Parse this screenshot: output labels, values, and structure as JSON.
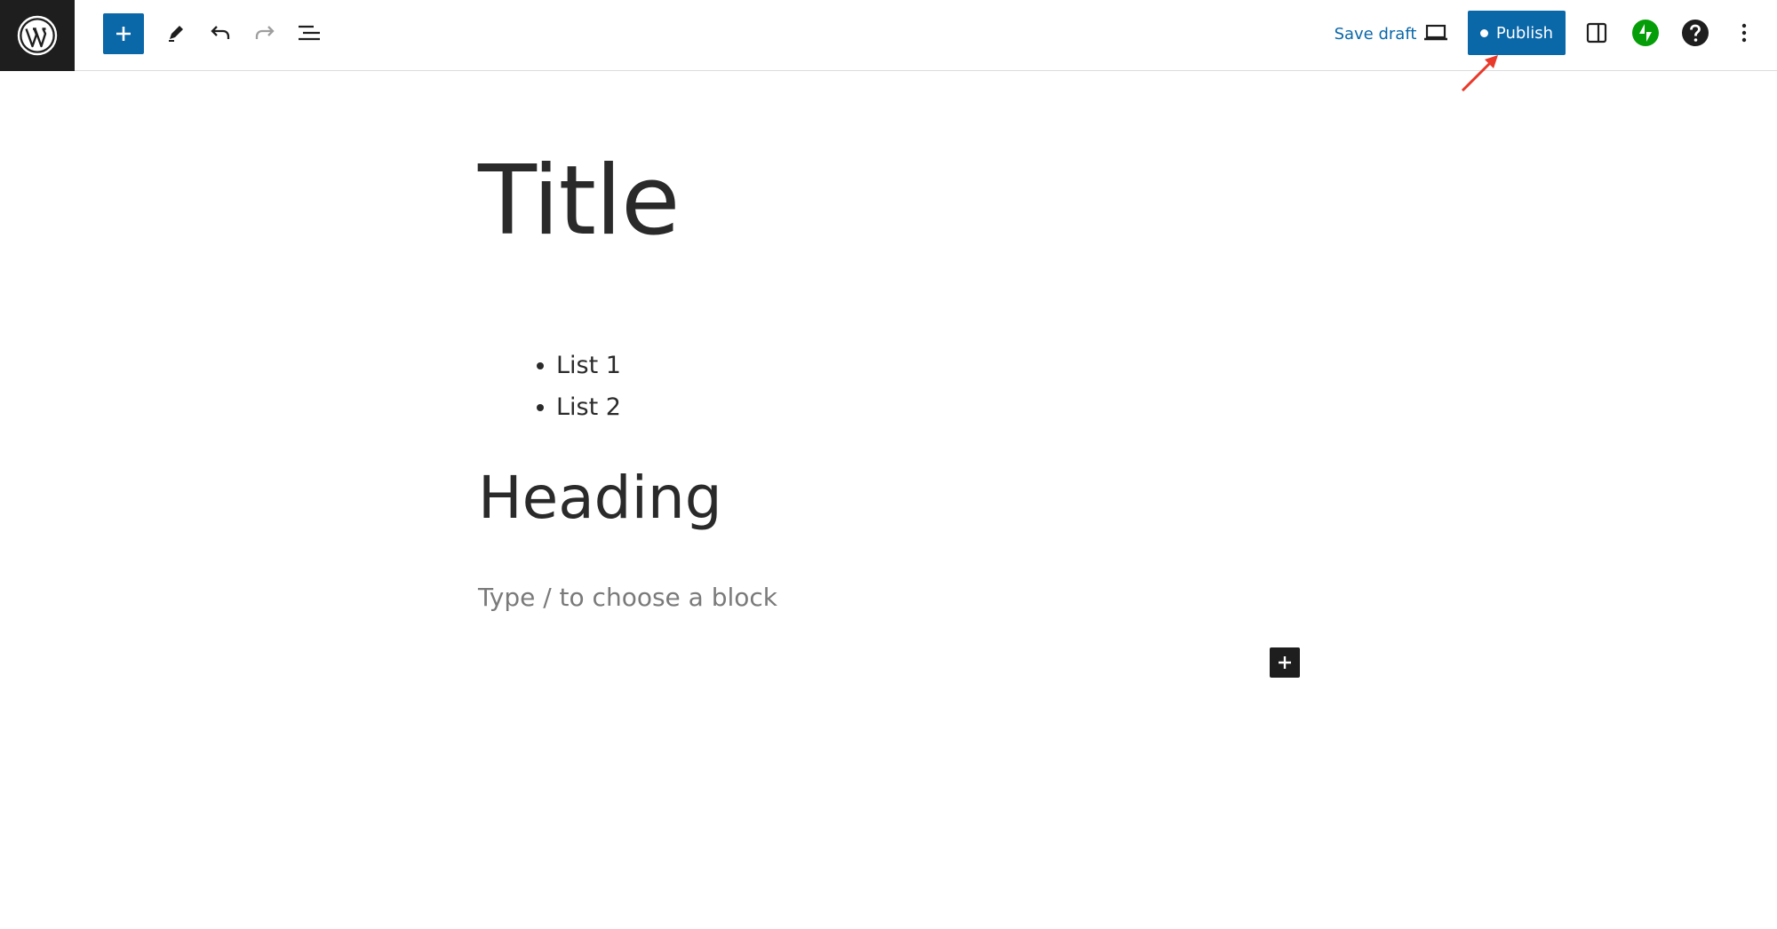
{
  "toolbar": {
    "logo_icon": "wordpress-logo-icon",
    "inserter_icon": "plus-icon",
    "tools_icon": "pencil-icon",
    "undo_icon": "undo-icon",
    "redo_icon": "redo-icon",
    "list_view_icon": "list-view-icon",
    "save_draft_label": "Save draft",
    "preview_icon": "laptop-icon",
    "publish_label": "Publish",
    "settings_icon": "sidebar-toggle-icon",
    "jetpack_icon": "jetpack-bolt-icon",
    "help_icon": "help-icon",
    "options_icon": "kebab-menu-icon"
  },
  "colors": {
    "accent": "#0a67a8",
    "dark": "#1e1e1e",
    "jetpack_green": "#069e08",
    "annotation_arrow": "#e8392a",
    "placeholder_text": "#7a7a7a"
  },
  "editor": {
    "title": "Title",
    "list_items": [
      "List 1",
      "List 2"
    ],
    "heading": "Heading",
    "placeholder": "Type / to choose a block"
  }
}
